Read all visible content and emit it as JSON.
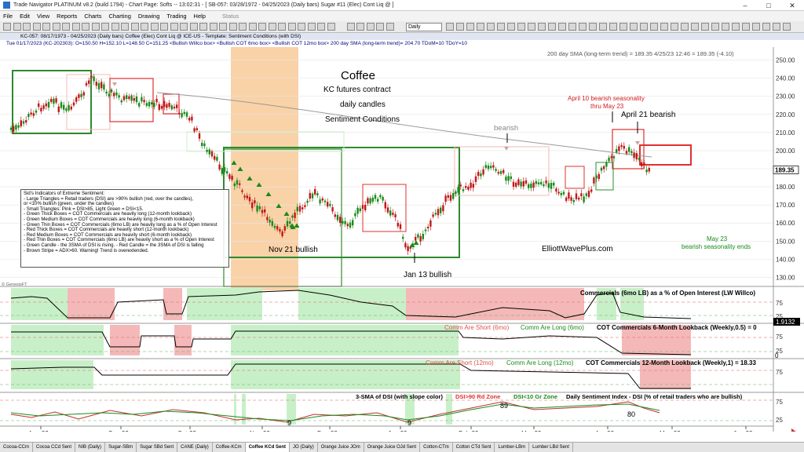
{
  "window": {
    "title": "Trade Navigator PLATINUM v8.2 (build 1794)  -  Chart Page: Softs  --  13:02:31  -  [ SB-057: 03/28/1972 - 04/25/2023  (Daily bars)   Sugar #11 (Elec) Cont Liq @ ]",
    "controls": [
      "–",
      "□",
      "✕"
    ]
  },
  "menu": [
    "File",
    "Edit",
    "View",
    "Reports",
    "Charts",
    "Charting",
    "Drawing",
    "Trading",
    "Help",
    "Status"
  ],
  "toolbar": {
    "period_select": "Daily"
  },
  "chart_header": {
    "symbol_line": "KC-057:  08/17/1973 - 04/25/2023 (Daily bars)     Coffee (Elec) Cont Liq @ ICE-US  -  Template: Sentiment Conditions (with DSI)",
    "data_line": "Tue  01/17/2023 (KC-202303):  O=150.50  H=152.10  L=148.50  C=151.25  <Bullish Willco box>  <Bullish COT 6mo box>  <Bullish COT 12mo box>  200 day SMA (long-term trend)= 204.70  TDoM=10  TDoY=10"
  },
  "price_panel": {
    "sma_readout": "200 day SMA (long-term trend) = 189.35   4/25/23 12:46 = 189.35 (-4.10)",
    "price_label": "189.35",
    "title_lines": [
      "Coffee",
      "KC futures contract",
      "daily candles",
      "Sentiment Conditions"
    ],
    "annotations": {
      "bearish": "bearish",
      "april_10_l1": "April 10 bearish seasonality",
      "april_10_l2": "thru May 23",
      "april_21": "April 21 bearish",
      "nov_21": "Nov 21 bullish",
      "jan_13": "Jan 13 bullish",
      "may_23_l1": "May 23",
      "may_23_l2": "bearish seasonality ends",
      "website": "ElliottWavePlus.com",
      "watermark": "© GenesisFT"
    },
    "legend": [
      "Sid's Indicators of Extreme Sentiment:",
      "- Large Triangles = Retail traders (DSI) are >90% bullish (red, over the candles),",
      "  or <10% bullish (green, under the candles)",
      "- Small Triangles: Pink = DSI>85, Light Green = DSI<15.",
      "- Green Thick Boxes = COT Commercials are heavily long (12-month lookback)",
      "- Green Medium Boxes = COT Commercials are heavily long (6-month lookback)",
      "- Green Thin Boxes = COT Commercials (6mo LB) are heavily long as a % of Open Interest",
      "- Red Thick Boxes = COT Commercials are heavily short (12-month lookback)",
      "- Red Medium Boxes = COT Commercials are heavily short (6-month lookback)",
      "- Red Thin Boxes = COT Commercials (6mo LB) are heavily short as a % of Open Interest",
      "- Green Candle - the 3SMA of DSI is rising.  - Red Candle = the 3SMA of DSI is falling",
      "- Brown Stripe = ADX>60. Warning! Trend is overextended."
    ],
    "y_axis_labels": [
      "250.00",
      "240.00",
      "230.00",
      "220.00",
      "210.00",
      "200.00",
      "190.00",
      "180.00",
      "170.00",
      "160.00",
      "150.00",
      "140.00",
      "130.00"
    ]
  },
  "panels": {
    "willco": {
      "title": "Commercials (6mo LB) as a % of Open Interest (LW Willco)",
      "value": "1.9132",
      "axis": [
        "75",
        "25"
      ]
    },
    "cot6": {
      "short_label": "Comm Are Short (6mo)",
      "long_label": "Comm Are Long (6mo)",
      "title": "COT Commercials 6-Month Lookback (Weekly,0.5) = 0",
      "axis": [
        "75",
        "25"
      ],
      "value": "0"
    },
    "cot12": {
      "short_label": "Comm Are Short (12mo)",
      "long_label": "Comm Are Long (12mo)",
      "title": "COT Commercials 12-Month Lookback (Weekly,1) = 18.33",
      "axis": [
        "75"
      ],
      "value": "18.33"
    },
    "dsi": {
      "title_a": "3-SMA of DSI (with slope color)",
      "red_zone": "DSI>90 Rd Zone",
      "green_zone": "DSI<10 Gr Zone",
      "title_b": "Daily Sentiment Index - DSI (% of retail traders who are bullish)",
      "labels": [
        "9",
        "9",
        "89",
        "80"
      ],
      "axis": [
        "75",
        "25"
      ]
    }
  },
  "x_axis": [
    "Aug-22",
    "Sep-22",
    "Oct-22",
    "Nov-22",
    "Dec-22",
    "Jan-23",
    "Feb-23",
    "Mar-23",
    "Apr-23",
    "May-23",
    "Jun-23"
  ],
  "tabs": [
    "Cocoa-CCm",
    "Cocoa CCd Sent",
    "NIB (Daily)",
    "Sugar-SBm",
    "Sugar SBd Sent",
    "CANE (Daily)",
    "Coffee-KCm",
    "Coffee KCd Sent",
    "JO (Daily)",
    "Orange Juice JOm",
    "Orange Juice OJd Sent",
    "Cotton-CTm",
    "Cotton CTd Sent",
    "Lumber-LBm",
    "Lumber LBd Sent"
  ],
  "active_tab": "Coffee KCd Sent",
  "colors": {
    "up": "#1a8a1a",
    "down": "#c01818",
    "green_box": "#2e8b2e",
    "red_box": "#e03030",
    "adx_stripe": "#f9d2a8",
    "pink": "#f4b8b8",
    "lightgreen": "#c8f0c8",
    "sma": "#9a9a9a"
  },
  "chart_data": {
    "type": "candlestick",
    "price_axis": {
      "min": 125,
      "max": 255,
      "ticks": [
        130,
        140,
        150,
        160,
        170,
        180,
        190,
        200,
        210,
        220,
        230,
        240,
        250
      ]
    },
    "close_path": [
      [
        "2022-08-01",
        212
      ],
      [
        "2022-08-08",
        222
      ],
      [
        "2022-08-15",
        228
      ],
      [
        "2022-08-22",
        221
      ],
      [
        "2022-08-29",
        232
      ],
      [
        "2022-09-01",
        241
      ],
      [
        "2022-09-08",
        233
      ],
      [
        "2022-09-15",
        228
      ],
      [
        "2022-09-22",
        227
      ],
      [
        "2022-09-29",
        226
      ],
      [
        "2022-10-06",
        224
      ],
      [
        "2022-10-13",
        218
      ],
      [
        "2022-10-20",
        200
      ],
      [
        "2022-10-27",
        190
      ],
      [
        "2022-11-03",
        180
      ],
      [
        "2022-11-10",
        169
      ],
      [
        "2022-11-17",
        161
      ],
      [
        "2022-11-21",
        153
      ],
      [
        "2022-11-28",
        168
      ],
      [
        "2022-12-05",
        176
      ],
      [
        "2022-12-12",
        168
      ],
      [
        "2022-12-19",
        158
      ],
      [
        "2022-12-26",
        170
      ],
      [
        "2023-01-02",
        174
      ],
      [
        "2023-01-09",
        162
      ],
      [
        "2023-01-13",
        146
      ],
      [
        "2023-01-20",
        154
      ],
      [
        "2023-01-27",
        168
      ],
      [
        "2023-02-03",
        178
      ],
      [
        "2023-02-10",
        182
      ],
      [
        "2023-02-17",
        193
      ],
      [
        "2023-02-24",
        186
      ],
      [
        "2023-03-03",
        180
      ],
      [
        "2023-03-10",
        183
      ],
      [
        "2023-03-17",
        180
      ],
      [
        "2023-03-24",
        172
      ],
      [
        "2023-03-31",
        176
      ],
      [
        "2023-04-07",
        192
      ],
      [
        "2023-04-14",
        202
      ],
      [
        "2023-04-21",
        196
      ],
      [
        "2023-04-25",
        189.35
      ]
    ],
    "sma200_latest": 189.35
  }
}
